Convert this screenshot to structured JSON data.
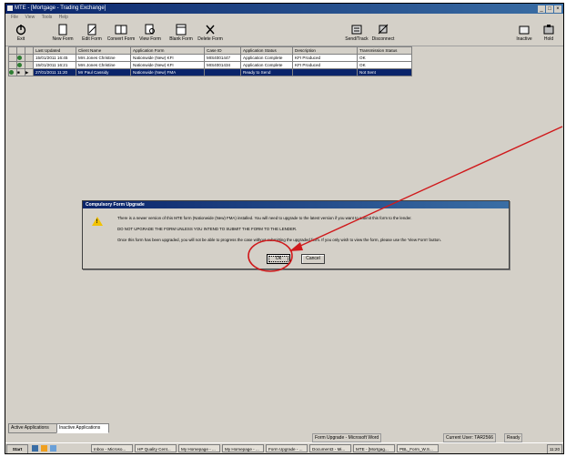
{
  "window": {
    "title": "MTE - [Mortgage - Trading Exchange]"
  },
  "menu": [
    "File",
    "View",
    "Tools",
    "Help"
  ],
  "toolbar": [
    {
      "name": "exit-button",
      "label": "Exit",
      "icon": "power-icon"
    },
    {
      "name": "new-form-button",
      "label": "New Form",
      "icon": "new-document-icon"
    },
    {
      "name": "edit-form-button",
      "label": "Edit Form",
      "icon": "edit-form-icon"
    },
    {
      "name": "convert-form-button",
      "label": "Convert Form",
      "icon": "convert-icon"
    },
    {
      "name": "view-form-button",
      "label": "View Form",
      "icon": "view-form-icon"
    },
    {
      "name": "blank-form-button",
      "label": "Blank Form",
      "icon": "blank-form-icon"
    },
    {
      "name": "delete-form-button",
      "label": "Delete Form",
      "icon": "delete-icon"
    },
    {
      "name": "send-track-button",
      "label": "Send/Track",
      "icon": "send-track-icon"
    },
    {
      "name": "disconnect-button",
      "label": "Disconnect",
      "icon": "disconnect-icon"
    },
    {
      "name": "inactive-button",
      "label": "Inactive",
      "icon": "inactive-icon"
    },
    {
      "name": "hold-button",
      "label": "Hold",
      "icon": "hold-icon"
    }
  ],
  "grid": {
    "columns": [
      "Last Updated",
      "Client Name",
      "Application Form",
      "Case ID",
      "Application Status",
      "Description",
      "Transmission Status"
    ],
    "rows": [
      [
        "15/01/2011 16:45",
        "Mrs Jones Christine",
        "Nationwide (New) KFI",
        "MIS4001447",
        "Application Complete",
        "KFI Produced",
        "OK"
      ],
      [
        "15/01/2011 16:21",
        "Mrs Jones Christine",
        "Nationwide (New) KFI",
        "MIS4001434",
        "Application Complete",
        "KFI Produced",
        "OK"
      ],
      [
        "27/01/2011 11:20",
        "Mr Paul Cassidy",
        "Nationwide (New) FMA",
        "",
        "Ready to Send",
        "",
        "Not Sent"
      ]
    ]
  },
  "dialog": {
    "title": "Compulsory Form Upgrade",
    "line1": "There is a newer version of this MTE form (Nationwide (New) FMA) installed. You will need to upgrade to the latest version if you want to submit this form to the lender.",
    "line2": "DO NOT UPGRADE THE FORM UNLESS YOU INTEND TO SUBMIT THE FORM TO THE LENDER.",
    "line3": "Once this form has been upgraded, you will not be able to progress the case without submitting the upgraded form. If you only wish to view the form, please use the 'View Form' button.",
    "ok": "Ok",
    "cancel": "Cancel",
    "warning_glyph": "!"
  },
  "tabs": [
    "Active Applications",
    "Inactive Applications"
  ],
  "status": {
    "doc": "Form Upgrade - Microsoft Word",
    "user": "Current User: TAR2566",
    "state": "Ready"
  },
  "taskbar": {
    "start": "Start",
    "tasks": [
      "Inbox - Microso...",
      "HP Quality Cent...",
      "My Homepage - ...",
      "My Homepage - ...",
      "Form Upgrade - ...",
      "Document3 - Mi...",
      "MTE - [Mortgag...",
      "PBL_Form_W.S..."
    ],
    "clock": "11:20"
  },
  "colors": {
    "annotation": "#d0191b",
    "title_blue": "#0a246a",
    "selected_row": "#0a246a"
  }
}
